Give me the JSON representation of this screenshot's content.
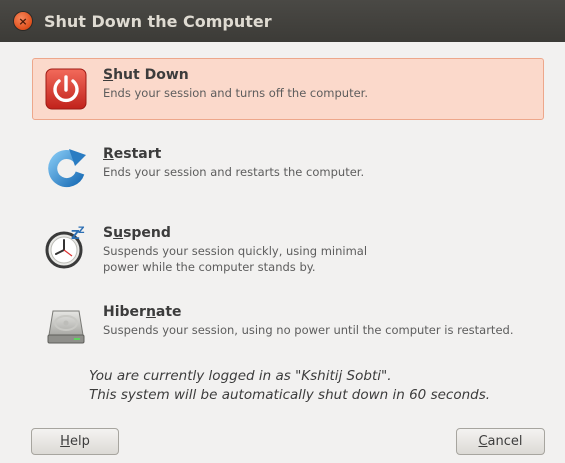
{
  "window": {
    "title": "Shut Down the Computer",
    "close_glyph": "×"
  },
  "options": [
    {
      "label_mnemonic": "S",
      "label_rest": "hut Down",
      "description_lines": [
        "Ends your session and turns off the computer."
      ],
      "icon": "power-icon",
      "selected": true
    },
    {
      "label_mnemonic": "R",
      "label_rest": "estart",
      "description_lines": [
        "Ends your session and restarts the computer."
      ],
      "icon": "restart-icon",
      "selected": false
    },
    {
      "label_pre": "S",
      "label_mnemonic": "u",
      "label_rest": "spend",
      "description_lines": [
        "Suspends your session quickly, using minimal",
        "power while the computer stands by."
      ],
      "icon": "suspend-clock-icon",
      "selected": false
    },
    {
      "label_pre": "Hiber",
      "label_mnemonic": "n",
      "label_rest": "ate",
      "description_lines": [
        "Suspends your session, using no power until the computer is restarted."
      ],
      "icon": "hard-drive-icon",
      "selected": false
    }
  ],
  "info": {
    "line1": "You are currently logged in as \"Kshitij Sobti\".",
    "line2": "This system will be automatically shut down in 60 seconds."
  },
  "buttons": {
    "help_mnemonic": "H",
    "help_rest": "elp",
    "cancel_mnemonic": "C",
    "cancel_rest": "ancel"
  },
  "colors": {
    "selected_bg": "#fbd9cb",
    "selected_border": "#eda78b",
    "titlebar": "#3c3b37",
    "accent_orange": "#e0501c"
  }
}
